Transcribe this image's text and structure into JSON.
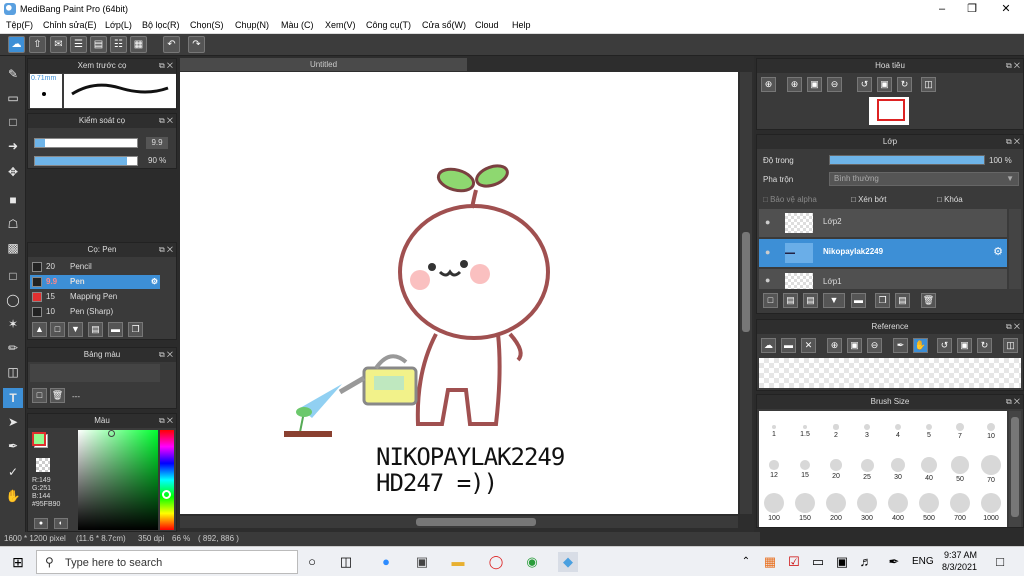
{
  "window": {
    "title": "MediBang Paint Pro (64bit)"
  },
  "menu": [
    "Tệp(F)",
    "Chỉnh sửa(E)",
    "Lớp(L)",
    "Bộ lọc(R)",
    "Chọn(S)",
    "Chụp(N)",
    "Màu (C)",
    "Xem(V)",
    "Công cụ(T)",
    "Cửa sổ(W)",
    "Cloud",
    "Help"
  ],
  "brush_preview": {
    "title": "Xem trước cọ",
    "size_label": "0.71mm"
  },
  "brush_control": {
    "title": "Kiểm soát cọ",
    "size_value": "9.9",
    "opacity_value": "90 %",
    "size_level": 0.1,
    "opacity_level": 0.9
  },
  "brush_list": {
    "title": "Cọ: Pen",
    "items": [
      {
        "size": "20",
        "name": "Pencil",
        "color": "#222222"
      },
      {
        "size": "9.9",
        "name": "Pen",
        "color": "#222222",
        "selected": true
      },
      {
        "size": "15",
        "name": "Mapping Pen",
        "color": "#e03030"
      },
      {
        "size": "10",
        "name": "Pen (Sharp)",
        "color": "#222222"
      }
    ]
  },
  "palette": {
    "title": "Bảng màu",
    "text": "---"
  },
  "color": {
    "title": "Màu",
    "r": "R:149",
    "g": "G:251",
    "b": "B:144",
    "hex": "#95FB90",
    "fg": "#95fb90"
  },
  "canvas": {
    "tab_title": "Untitled",
    "text_line1": "NIKOPAYLAK2249",
    "text_line2": "HD247 =))"
  },
  "status": {
    "dims": "1600 * 1200 pixel",
    "size_cm": "(11.6 * 8.7cm)",
    "dpi": "350 dpi",
    "zoom": "66 %",
    "coords": "( 892, 886 )"
  },
  "navigator": {
    "title": "Hoa tiêu"
  },
  "layers": {
    "title": "Lớp",
    "opacity_label": "Độ trong",
    "opacity_value": "100 %",
    "opacity_level": 1.0,
    "blend_label": "Pha trộn",
    "blend_value": "Bình thường",
    "protect_alpha": "Bảo vệ alpha",
    "clipping": "Xén bớt",
    "lock": "Khóa",
    "items": [
      {
        "name": "Lớp2",
        "selected": false
      },
      {
        "name": "Nikopaylak2249",
        "selected": true
      },
      {
        "name": "Lớp1",
        "selected": false
      }
    ]
  },
  "reference": {
    "title": "Reference"
  },
  "brush_size": {
    "title": "Brush Size",
    "sizes": [
      "1",
      "1.5",
      "2",
      "3",
      "4",
      "5",
      "7",
      "10",
      "12",
      "15",
      "20",
      "25",
      "30",
      "40",
      "50",
      "70",
      "100",
      "150",
      "200",
      "300",
      "400",
      "500",
      "700",
      "1000"
    ]
  },
  "taskbar": {
    "search_placeholder": "Type here to search",
    "time": "9:37 AM",
    "date": "8/3/2021",
    "lang": "ENG"
  }
}
